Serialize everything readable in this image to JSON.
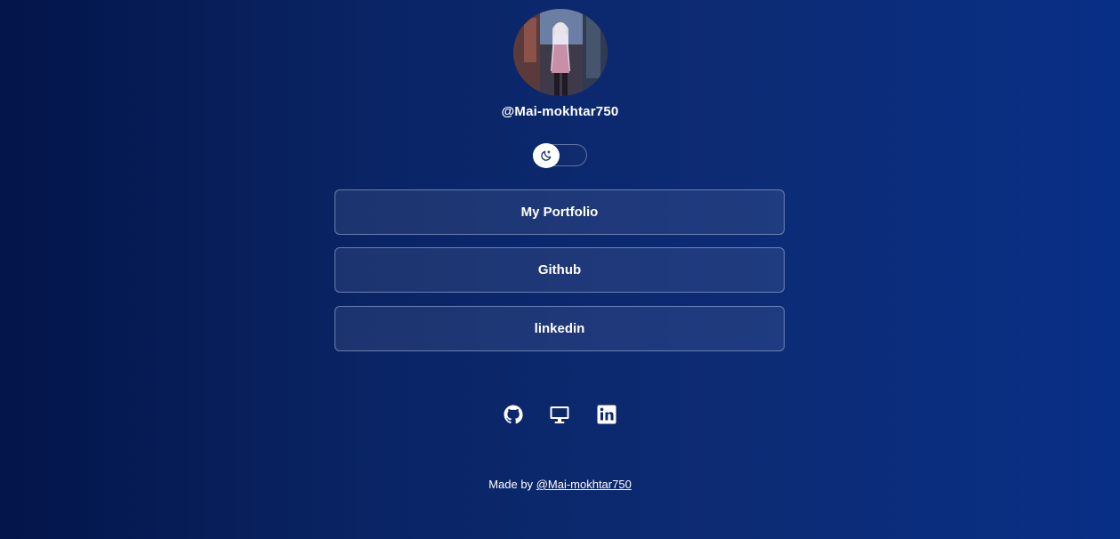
{
  "profile": {
    "username": "@Mai-mokhtar750",
    "avatar_icon": "profile-photo"
  },
  "theme_toggle": {
    "icon": "moon-icon",
    "state": "off"
  },
  "links": [
    {
      "label": "My Portfolio"
    },
    {
      "label": "Github"
    },
    {
      "label": "linkedin"
    }
  ],
  "social_icons": [
    "github-icon",
    "desktop-icon",
    "linkedin-icon"
  ],
  "footer": {
    "prefix": "Made by",
    "link_text": "@Mai-mokhtar750"
  },
  "colors": {
    "background_start": "#03154a",
    "background_end": "#082f86",
    "text": "#ffffff"
  }
}
